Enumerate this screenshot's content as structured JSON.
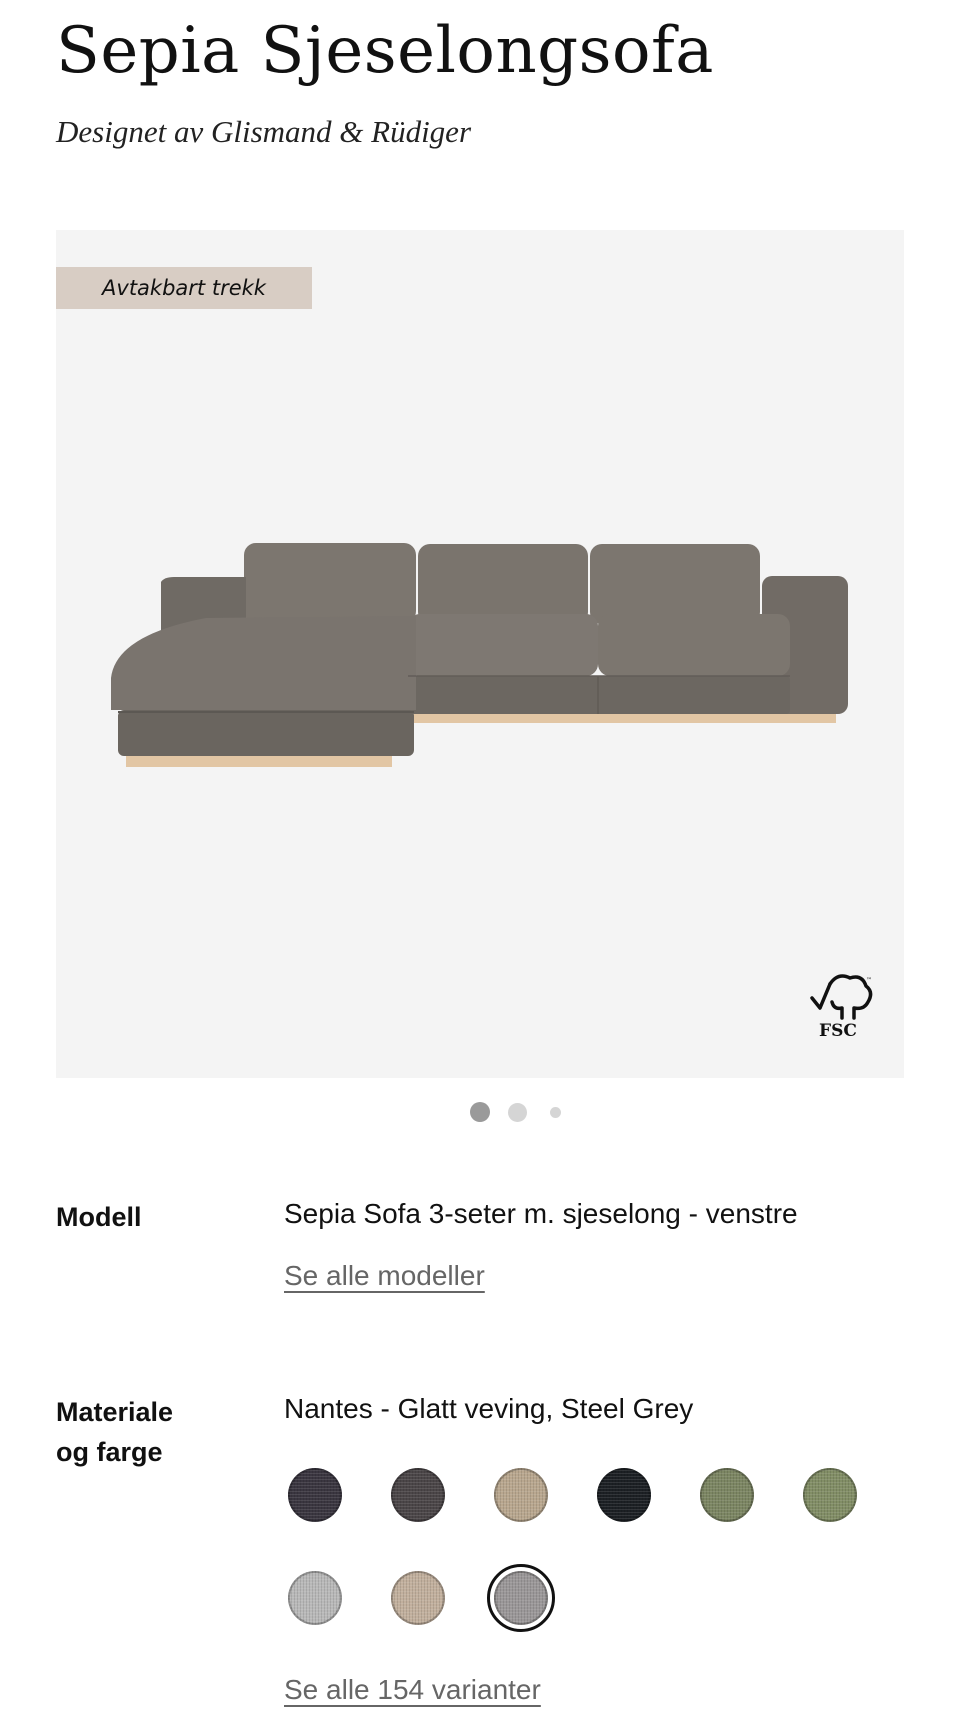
{
  "product": {
    "title": "Sepia Sjeselongsofa",
    "designer": "Designet av Glismand & Rüdiger"
  },
  "gallery": {
    "badge": "Avtakbart trekk",
    "certification_logo": "FSC",
    "image_count": 3,
    "active_index": 0,
    "sofa_color": "#7d7770",
    "base_color": "#e2c6a4"
  },
  "model": {
    "label": "Modell",
    "value": "Sepia Sofa 3-seter m. sjeselong - venstre",
    "link": "Se alle modeller"
  },
  "material": {
    "label_line1": "Materiale",
    "label_line2": "og farge",
    "value": "Nantes - Glatt veving, Steel Grey",
    "swatches": [
      {
        "color": "#3a3640",
        "selected": false
      },
      {
        "color": "#4b4648",
        "selected": false
      },
      {
        "color": "#b9a78f",
        "selected": false
      },
      {
        "color": "#1c2024",
        "selected": false
      },
      {
        "color": "#7c8663",
        "selected": false
      },
      {
        "color": "#828e66",
        "selected": false
      },
      {
        "color": "#b9b9b9",
        "selected": false
      },
      {
        "color": "#c2b09e",
        "selected": false
      },
      {
        "color": "#9b9899",
        "selected": true
      }
    ],
    "link": "Se alle 154 varianter"
  }
}
